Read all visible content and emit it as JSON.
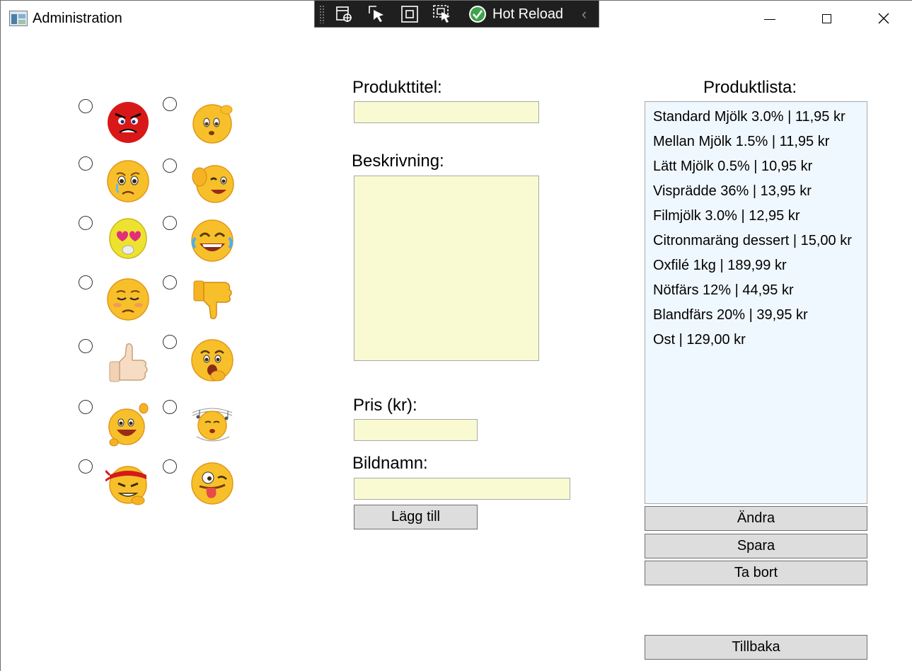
{
  "window": {
    "title": "Administration",
    "controls": [
      "minimize",
      "maximize",
      "close"
    ]
  },
  "debug_toolbar": {
    "hot_reload_label": "Hot Reload"
  },
  "emoji_options": [
    {
      "icon": "angry-red-face-icon"
    },
    {
      "icon": "confused-scratching-head-icon"
    },
    {
      "icon": "crying-face-icon"
    },
    {
      "icon": "thumbs-up-wink-face-icon"
    },
    {
      "icon": "heart-eyes-face-icon"
    },
    {
      "icon": "tears-of-joy-face-icon"
    },
    {
      "icon": "sad-blushing-face-icon"
    },
    {
      "icon": "thumbs-down-icon"
    },
    {
      "icon": "thumbs-up-hand-icon"
    },
    {
      "icon": "yawning-face-icon"
    },
    {
      "icon": "cheering-face-icon"
    },
    {
      "icon": "music-note-face-icon"
    },
    {
      "icon": "ninja-headband-face-icon"
    },
    {
      "icon": "silly-tongue-face-icon"
    }
  ],
  "form": {
    "title_label": "Produkttitel:",
    "title_value": "",
    "description_label": "Beskrivning:",
    "description_value": "",
    "price_label": "Pris (kr):",
    "price_value": "",
    "image_label": "Bildnamn:",
    "image_value": "",
    "add_button": "Lägg till"
  },
  "product_list": {
    "label": "Produktlista:",
    "items": [
      "Standard Mjölk 3.0% | 11,95 kr",
      "Mellan Mjölk 1.5% | 11,95 kr",
      "Lätt Mjölk 0.5% | 10,95 kr",
      "Visprädde 36% | 13,95 kr",
      "Filmjölk 3.0% | 12,95 kr",
      "Citronmaräng dessert | 15,00 kr",
      "Oxfilé 1kg | 189,99 kr",
      "Nötfärs 12% | 44,95 kr",
      "Blandfärs 20% | 39,95 kr",
      "Ost | 129,00 kr"
    ]
  },
  "actions": {
    "edit": "Ändra",
    "save": "Spara",
    "delete": "Ta bort",
    "back": "Tillbaka"
  },
  "colors": {
    "input_background": "#fafad2",
    "list_background": "#f0f8ff",
    "button_background": "#dddddd",
    "toolbar_background": "#1f1f1f"
  }
}
